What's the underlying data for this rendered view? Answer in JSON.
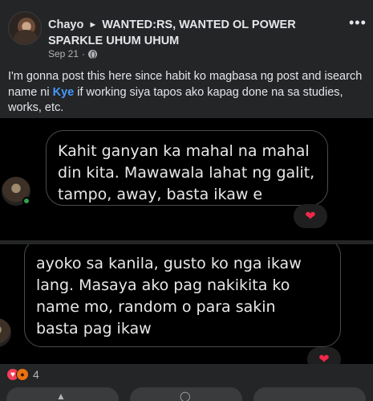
{
  "post": {
    "author": "Chayo",
    "target": "WANTED:RS, WANTED OL POWER SPARKLE UHUM UHUM",
    "date": "Sep 21",
    "dot": "·",
    "arrow": "►",
    "caption_before": "I'm gonna post this here since habit ko magbasa ng post and isearch name ni ",
    "caption_tag": "Kye",
    "caption_after": " if working siya tapos ako kapag done na sa studies, works, etc."
  },
  "images": [
    {
      "bubble_lines": [
        "Kahit ganyan ka mahal na mahal",
        "din kita. Mawawala lahat ng galit,",
        "tampo, away, basta ikaw e"
      ],
      "reaction": "❤"
    },
    {
      "bubble_lines": [
        "ayoko sa kanila, gusto ko nga ikaw",
        "lang. Masaya ako pag nakikita ko",
        "name mo, random o para sakin",
        "basta pag ikaw"
      ],
      "reaction": "❤"
    }
  ],
  "reactions": {
    "count": "4",
    "icons": [
      "love-icon",
      "angry-icon"
    ]
  },
  "icons": {
    "more": "more-horizontal-icon",
    "globe": "globe-icon"
  },
  "colors": {
    "background": "#242526",
    "text": "#e4e6eb",
    "secondary": "#b0b3b8",
    "mention": "#4599ff",
    "love": "#f33e58",
    "angry": "#e9710f"
  }
}
